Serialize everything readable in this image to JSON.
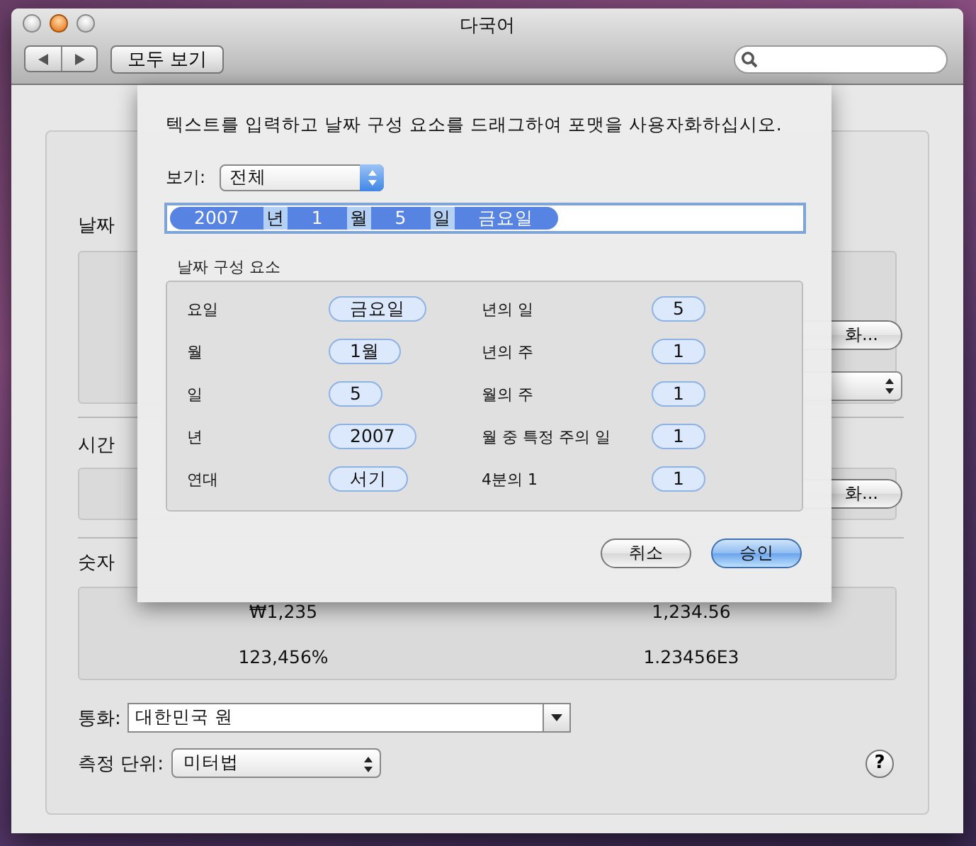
{
  "window": {
    "title": "다국어"
  },
  "toolbar": {
    "show_all": "모두 보기"
  },
  "date_section": {
    "label": "날짜",
    "customize": "화..."
  },
  "time_section": {
    "label": "시간",
    "customize": "화..."
  },
  "number_section": {
    "label": "숫자",
    "samples": [
      "₩1,235",
      "1,234.56",
      "123,456%",
      "1.23456E3"
    ]
  },
  "currency": {
    "label": "통화:",
    "value": "대한민국 원"
  },
  "units": {
    "label": "측정 단위:",
    "value": "미터법"
  },
  "help": "?",
  "sheet": {
    "instruction": "텍스트를 입력하고 날짜 구성 요소를 드래그하여 포맷을 사용자화하십시오.",
    "show": {
      "label": "보기:",
      "value": "전체"
    },
    "format_tokens": [
      {
        "text": "2007",
        "kind": "token"
      },
      {
        "text": "년",
        "kind": "literal"
      },
      {
        "text": "1",
        "kind": "token"
      },
      {
        "text": "월",
        "kind": "literal"
      },
      {
        "text": "5",
        "kind": "token"
      },
      {
        "text": "일",
        "kind": "literal"
      },
      {
        "text": "금요일",
        "kind": "token"
      }
    ],
    "group_title": "날짜 구성 요소",
    "elements": [
      {
        "name": "요일",
        "token": "금요일"
      },
      {
        "name": "년의 일",
        "token": "5"
      },
      {
        "name": "월",
        "token": "1월"
      },
      {
        "name": "년의 주",
        "token": "1"
      },
      {
        "name": "일",
        "token": "5"
      },
      {
        "name": "월의 주",
        "token": "1"
      },
      {
        "name": "년",
        "token": "2007"
      },
      {
        "name": "월 중 특정 주의 일",
        "token": "1"
      },
      {
        "name": "연대",
        "token": "서기"
      },
      {
        "name": "4분의 1",
        "token": "1"
      }
    ],
    "buttons": [
      {
        "label": "취소",
        "default": false
      },
      {
        "label": "승인",
        "default": true
      }
    ]
  }
}
